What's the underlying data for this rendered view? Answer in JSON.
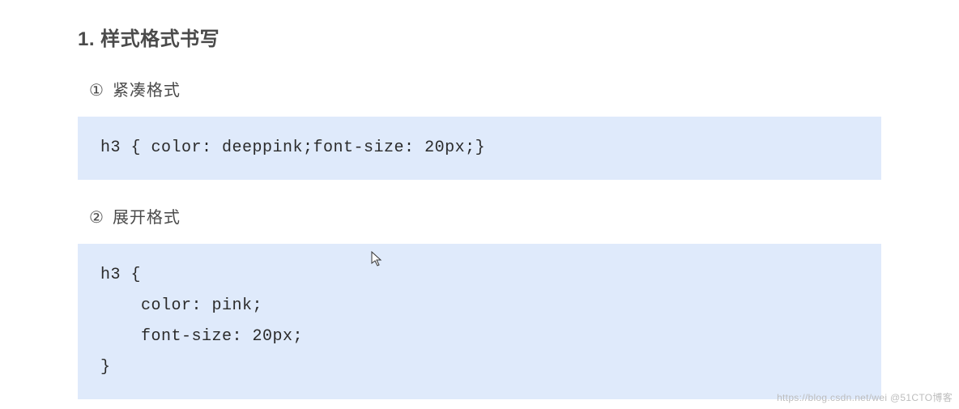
{
  "heading": "1. 样式格式书写",
  "section1": {
    "marker": "①",
    "title": "紧凑格式",
    "code": "h3 { color: deeppink;font-size: 20px;}"
  },
  "section2": {
    "marker": "②",
    "title": "展开格式",
    "code": "h3 {\n    color: pink;\n    font-size: 20px;\n}"
  },
  "watermark": "https://blog.csdn.net/wei @51CTO博客"
}
